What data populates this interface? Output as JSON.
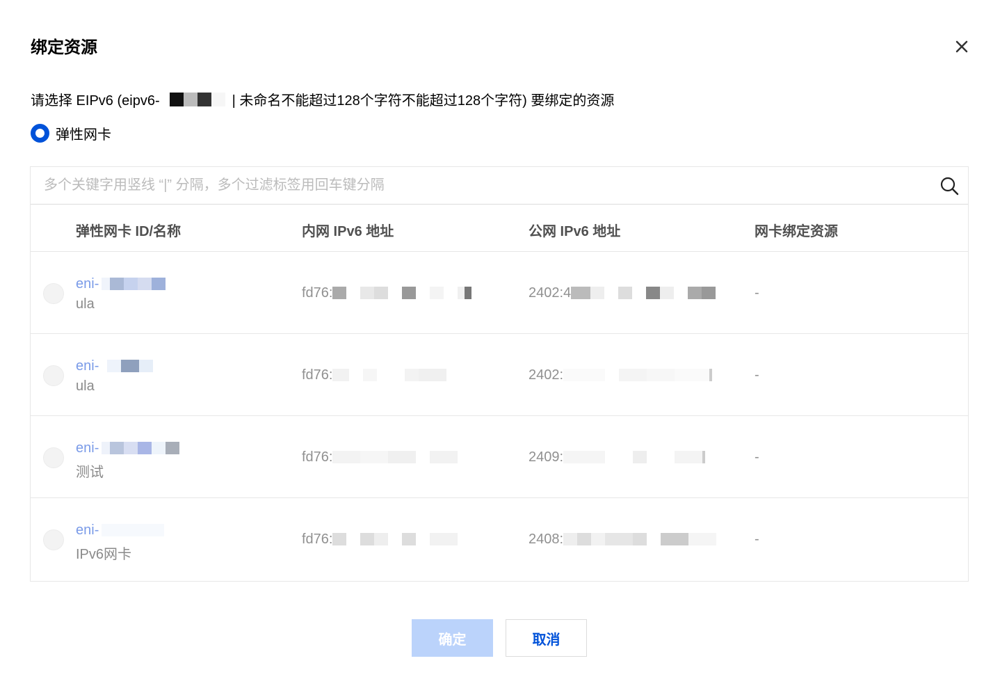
{
  "dialog": {
    "title": "绑定资源",
    "prompt_prefix": "请选择 EIPv6 (eipv6-",
    "prompt_suffix": "| 未命名不能超过128个字符不能超过128个字符) 要绑定的资源",
    "resource_type_label": "弹性网卡",
    "search_placeholder": "多个关键字用竖线 “|” 分隔，多个过滤标签用回车键分隔"
  },
  "table": {
    "columns": [
      "弹性网卡 ID/名称",
      "内网 IPv6 地址",
      "公网 IPv6 地址",
      "网卡绑定资源"
    ],
    "rows": [
      {
        "id_prefix": "eni-",
        "name": "ula",
        "private_ipv6_prefix": "fd76:",
        "public_ipv6_prefix": "2402:4",
        "bound_resource": "-"
      },
      {
        "id_prefix": "eni-",
        "name": "ula",
        "private_ipv6_prefix": "fd76:",
        "public_ipv6_prefix": "2402:",
        "bound_resource": "-"
      },
      {
        "id_prefix": "eni-",
        "name": "测试",
        "private_ipv6_prefix": "fd76:",
        "public_ipv6_prefix": "2409:",
        "bound_resource": "-"
      },
      {
        "id_prefix": "eni-",
        "name": "IPv6网卡",
        "private_ipv6_prefix": "fd76:",
        "public_ipv6_prefix": "2408:",
        "bound_resource": "-"
      }
    ]
  },
  "buttons": {
    "confirm": "确定",
    "cancel": "取消"
  },
  "colors": {
    "primary": "#0052d9",
    "confirm_disabled_bg": "#bbd3fb",
    "link": "#7a9be8"
  },
  "icons": {
    "close": "close-icon",
    "search": "search-icon"
  }
}
